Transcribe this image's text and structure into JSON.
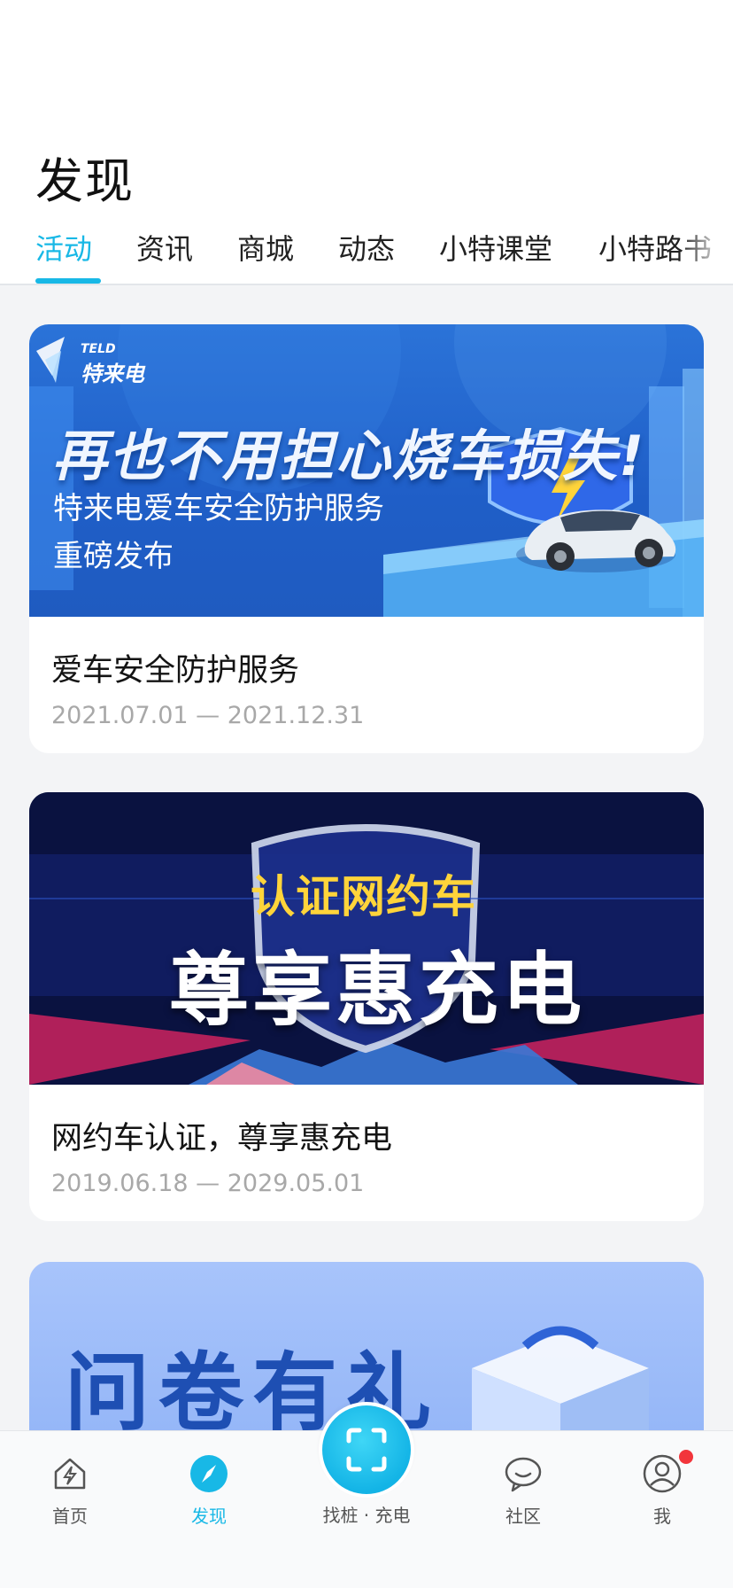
{
  "page": {
    "title": "发现"
  },
  "tabs": [
    {
      "label": "活动",
      "active": true
    },
    {
      "label": "资讯",
      "active": false
    },
    {
      "label": "商城",
      "active": false
    },
    {
      "label": "动态",
      "active": false
    },
    {
      "label": "小特课堂",
      "active": false
    },
    {
      "label": "小特路书",
      "active": false
    }
  ],
  "cards": [
    {
      "banner": {
        "logo_en": "TELD",
        "logo_cn": "特来电",
        "headline": "再也不用担心烧车损失!",
        "line1": "特来电爱车安全防护服务",
        "line2": "重磅发布"
      },
      "title": "爱车安全防护服务",
      "date_range": "2021.07.01 — 2021.12.31"
    },
    {
      "banner": {
        "top": "认证网约车",
        "main": "尊享惠充电"
      },
      "title": "网约车认证，尊享惠充电",
      "date_range": "2019.06.18 — 2029.05.01"
    },
    {
      "banner": {
        "title": "问卷有礼"
      }
    }
  ],
  "bottom_nav": {
    "items": [
      {
        "label": "首页",
        "icon": "home-charge-icon",
        "active": false
      },
      {
        "label": "发现",
        "icon": "compass-icon",
        "active": true
      },
      {
        "label": "找桩 · 充电",
        "icon": "scan-icon",
        "active": false
      },
      {
        "label": "社区",
        "icon": "chat-bubble-icon",
        "active": false
      },
      {
        "label": "我",
        "icon": "user-icon",
        "active": false,
        "badge": true
      }
    ]
  },
  "colors": {
    "accent": "#18b8e6",
    "badge": "#f2353b"
  }
}
